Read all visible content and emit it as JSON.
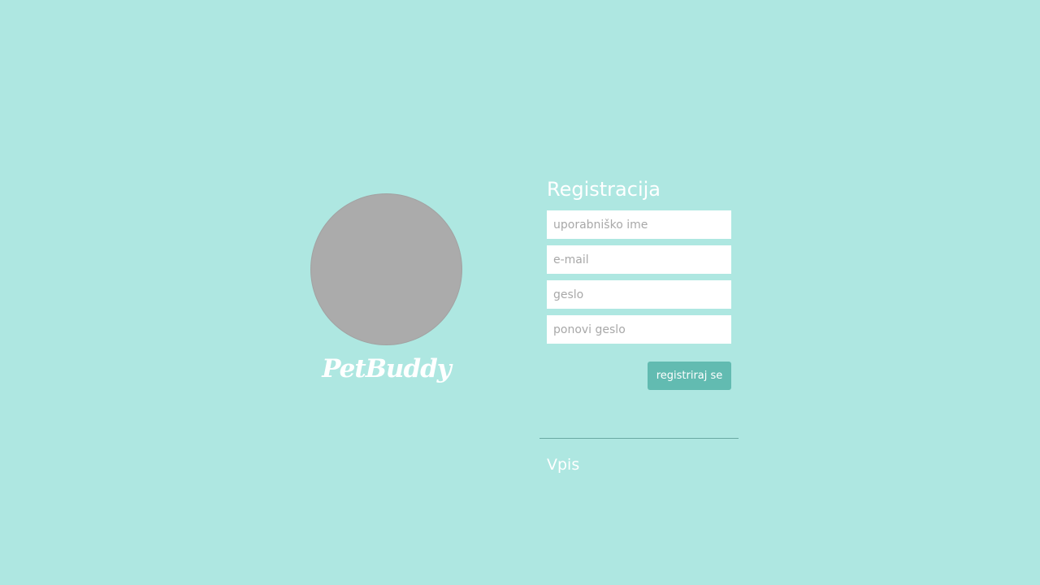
{
  "brand": {
    "name": "PetBuddy",
    "avatar_icon": "avatar-placeholder-icon"
  },
  "register_form": {
    "title": "Registracija",
    "fields": {
      "username": {
        "value": "",
        "placeholder": "uporabniško ime"
      },
      "email": {
        "value": "",
        "placeholder": "e-mail"
      },
      "password": {
        "value": "",
        "placeholder": "geslo"
      },
      "repeat_password": {
        "value": "",
        "placeholder": "ponovi geslo"
      }
    },
    "submit_label": "registriraj se"
  },
  "login_link": {
    "label": "Vpis"
  },
  "colors": {
    "background": "#aee7e1",
    "button": "#62bbb1",
    "avatar": "#ababab",
    "text": "#ffffff"
  }
}
